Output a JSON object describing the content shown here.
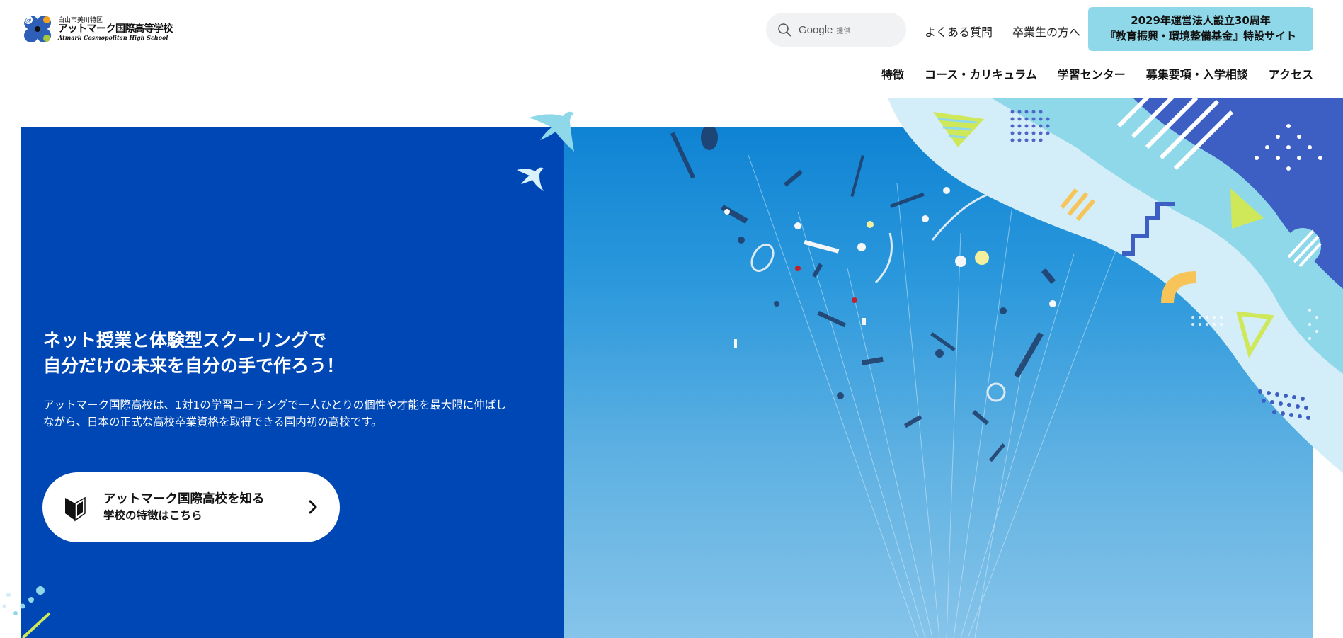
{
  "logo": {
    "subtitle": "白山市美川特区",
    "name": "アットマーク国際高等学校",
    "english": "Atmark Cosmopolitan High School"
  },
  "search": {
    "brand": "Google",
    "provided": "提供"
  },
  "top_links": {
    "faq": "よくある質問",
    "graduates": "卒業生の方へ"
  },
  "special_site": {
    "line1": "2029年運営法人設立30周年",
    "line2": "『教育振興・環境整備基金』特設サイト"
  },
  "nav": [
    {
      "label": "特徴"
    },
    {
      "label": "コース・カリキュラム"
    },
    {
      "label": "学習センター"
    },
    {
      "label": "募集要項・入学相談"
    },
    {
      "label": "アクセス"
    }
  ],
  "hero": {
    "headline_line1": "ネット授業と体験型スクーリングで",
    "headline_line2": "自分だけの未来を自分の手で作ろう！",
    "body_line1": "アットマーク国際高校は、1対1の学習コーチングで一人ひとりの個性や才能を最大限に伸ばし",
    "body_line2": "ながら、日本の正式な高校卒業資格を取得できる国内初の高校です。",
    "cta_title": "アットマーク国際高校を知る",
    "cta_subtitle": "学校の特徴はこちら"
  },
  "colors": {
    "hero_blue": "#0047b6",
    "special_button": "#8fd8ea",
    "accent_yellow": "#f7c45a",
    "accent_lime": "#cfe85a",
    "accent_light_blue": "#8fd8ea"
  },
  "icons": [
    "search-icon",
    "beginner-mark-icon",
    "chevron-right-icon",
    "bird-icon"
  ]
}
